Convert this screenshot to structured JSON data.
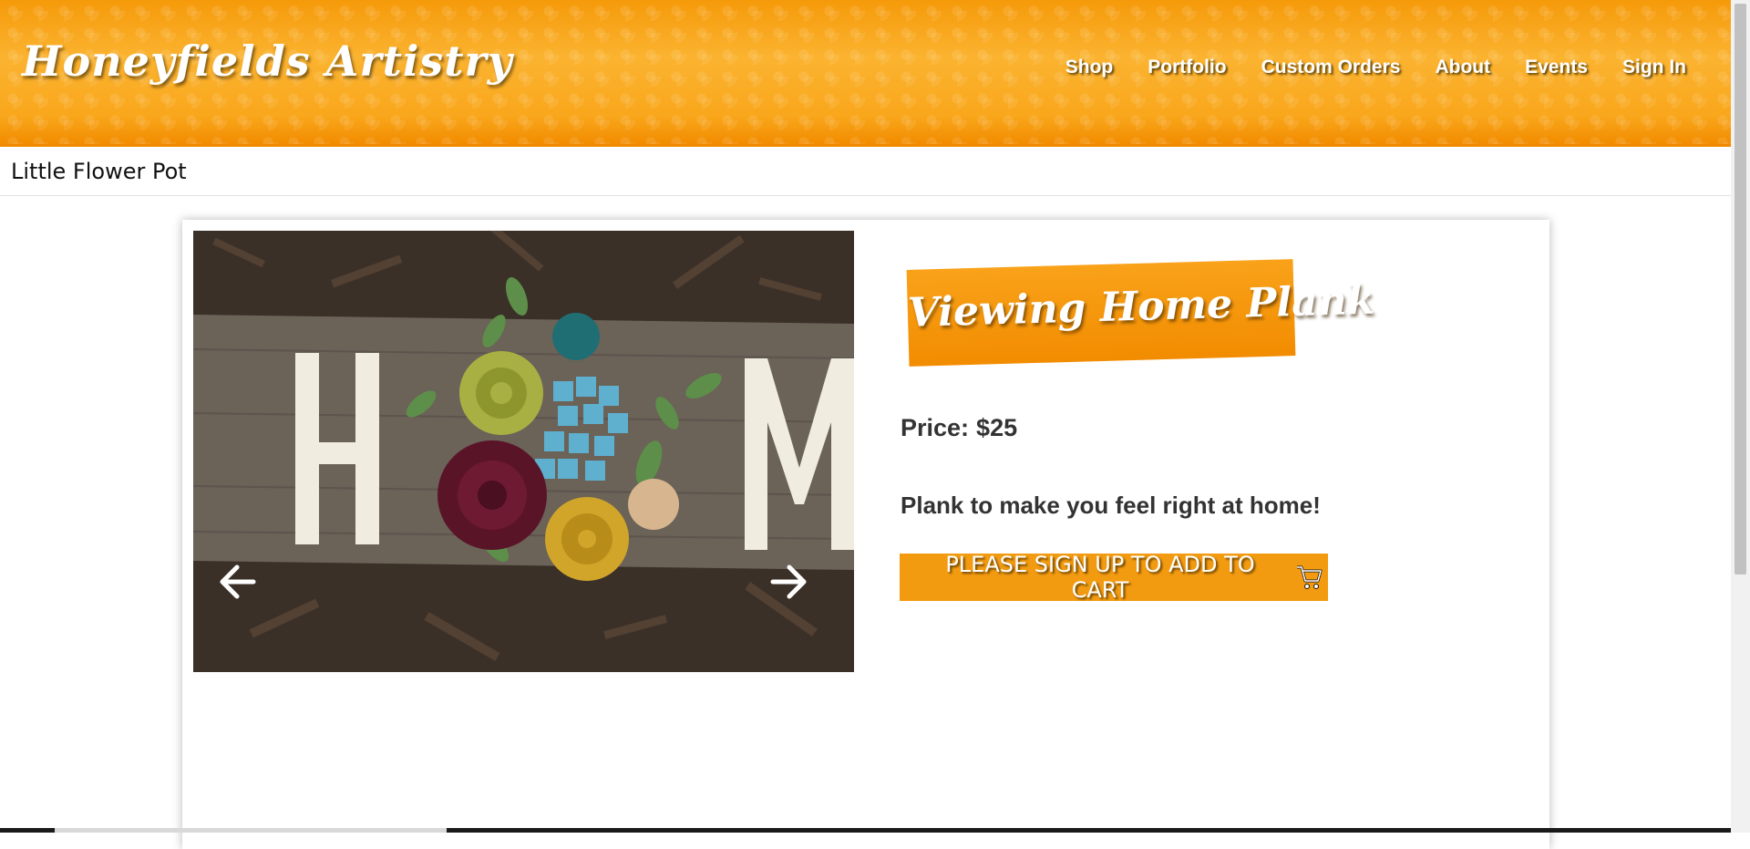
{
  "header": {
    "logo": "Honeyfields Artistry",
    "nav": [
      {
        "label": "Shop"
      },
      {
        "label": "Portfolio"
      },
      {
        "label": "Custom Orders"
      },
      {
        "label": "About"
      },
      {
        "label": "Events"
      },
      {
        "label": "Sign In"
      }
    ]
  },
  "breadcrumb": {
    "label": "Little Flower Pot"
  },
  "product": {
    "banner_title": "Viewing Home Plank",
    "price_label": "Price:",
    "price_value": "$25",
    "description": "Plank to make you feel right at home!",
    "cart_button": "PLEASE SIGN UP TO ADD TO CART",
    "cart_icon": "shopping-cart-icon",
    "carousel": {
      "prev_icon": "arrow-left-icon",
      "next_icon": "arrow-right-icon"
    }
  },
  "colors": {
    "accent": "#f39b10",
    "header": "#f9a71c",
    "text": "#333333"
  }
}
